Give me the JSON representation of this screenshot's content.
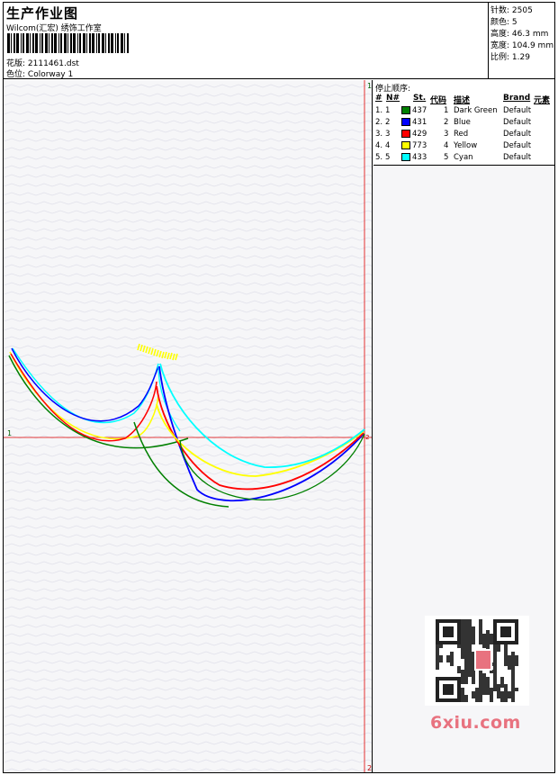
{
  "header": {
    "title": "生产作业图",
    "company": "Wilcom(汇宏) 绣饰工作室",
    "design_label": "花版:",
    "design_value": "2111461.dst",
    "colorway_label": "色位:",
    "colorway_value": "Colorway 1"
  },
  "stats": {
    "stitches_label": "针数:",
    "stitches": "2505",
    "colors_label": "颜色:",
    "colors": "5",
    "height_label": "高度:",
    "height": "46.3 mm",
    "width_label": "宽度:",
    "width": "104.9 mm",
    "scale_label": "比例:",
    "scale": "1.29"
  },
  "sequence": {
    "title": "停止顺序:",
    "columns": [
      "#",
      "N#",
      "St.",
      "代码",
      "描述",
      "Brand",
      "元素"
    ],
    "rows": [
      {
        "idx": "1.",
        "n": "1",
        "st": "437",
        "code": "1",
        "desc": "Dark Green",
        "brand": "Default",
        "color": "#008000"
      },
      {
        "idx": "2.",
        "n": "2",
        "st": "431",
        "code": "2",
        "desc": "Blue",
        "brand": "Default",
        "color": "#0000ff"
      },
      {
        "idx": "3.",
        "n": "3",
        "st": "429",
        "code": "3",
        "desc": "Red",
        "brand": "Default",
        "color": "#ff0000"
      },
      {
        "idx": "4.",
        "n": "4",
        "st": "773",
        "code": "4",
        "desc": "Yellow",
        "brand": "Default",
        "color": "#ffff00"
      },
      {
        "idx": "5.",
        "n": "5",
        "st": "433",
        "code": "5",
        "desc": "Cyan",
        "brand": "Default",
        "color": "#00ffff"
      }
    ]
  },
  "axis_markers": {
    "top": "1",
    "left": "1",
    "bottom": "2",
    "right": "2"
  },
  "brand_watermark": "6xiu.com"
}
